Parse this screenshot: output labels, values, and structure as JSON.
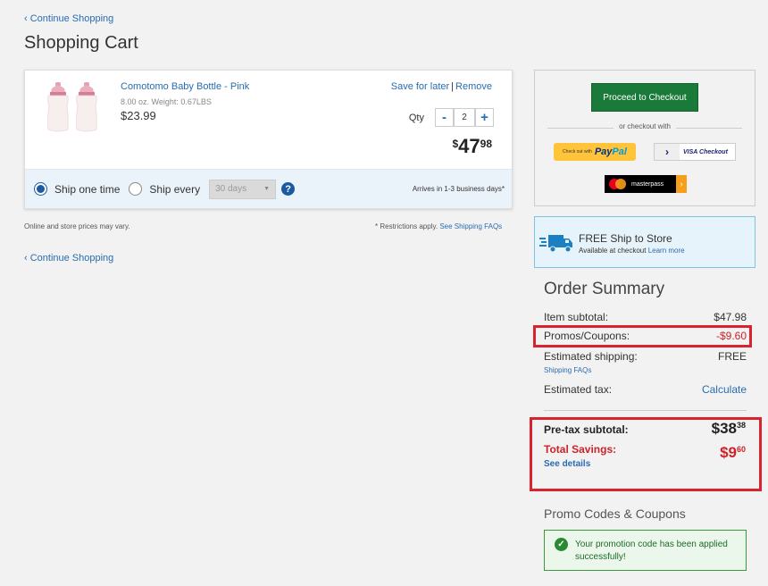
{
  "nav": {
    "continue_top": "‹ Continue Shopping",
    "continue_bottom": "‹ Continue Shopping"
  },
  "page": {
    "title": "Shopping Cart"
  },
  "item": {
    "name": "Comotomo Baby Bottle - Pink",
    "meta": "8.00 oz.  Weight: 0.67LBS",
    "price": "$23.99",
    "save_for_later": "Save for later",
    "separator": "|",
    "remove": "Remove",
    "qty_label": "Qty",
    "qty_value": "2",
    "qty_minus": "-",
    "qty_plus": "+",
    "line_total_currency": "$",
    "line_total_dollars": "47",
    "line_total_cents": "98",
    "image_icon": "baby-bottle-icon"
  },
  "shipping_options": {
    "ship_one_time": "Ship one time",
    "ship_every": "Ship every",
    "frequency_value": "30 days",
    "help": "?",
    "arrives": "Arrives in 1-3 business days*"
  },
  "notes": {
    "prices_vary": "Online and store prices may vary.",
    "restrictions": "* Restrictions apply.",
    "shipping_faqs_link": "See Shipping FAQs"
  },
  "checkout": {
    "proceed_label": "Proceed to Checkout",
    "or_checkout_with": "or checkout with",
    "paypal_small": "Check out with",
    "paypal_pay": "Pay",
    "paypal_pal": "Pal",
    "visa_label": "VISA Checkout",
    "visa_chevron": "›",
    "masterpass_label": "masterpass",
    "masterpass_arrow": "›"
  },
  "ship_to_store": {
    "title": "FREE Ship to Store",
    "subtitle": "Available at checkout",
    "learn_more": "Learn more"
  },
  "order_summary": {
    "title": "Order Summary",
    "item_subtotal_label": "Item subtotal:",
    "item_subtotal_value": "$47.98",
    "promos_label": "Promos/Coupons:",
    "promos_value": "-$9.60",
    "shipping_label": "Estimated shipping:",
    "shipping_value": "FREE",
    "shipping_faqs": "Shipping FAQs",
    "tax_label": "Estimated tax:",
    "tax_value": "Calculate",
    "pretax_label": "Pre-tax subtotal:",
    "pretax_dollars": "$38",
    "pretax_cents": "38",
    "savings_label": "Total Savings:",
    "savings_dollars": "$9",
    "savings_cents": "60",
    "see_details": "See details"
  },
  "promo": {
    "title": "Promo Codes & Coupons",
    "success_message": "Your promotion code has been applied successfully!",
    "check_glyph": "✓"
  },
  "colors": {
    "brand_blue": "#2a6cb0",
    "checkout_green": "#1a7a3a",
    "highlight_red": "#d9232e",
    "savings_red": "#cc2229"
  }
}
